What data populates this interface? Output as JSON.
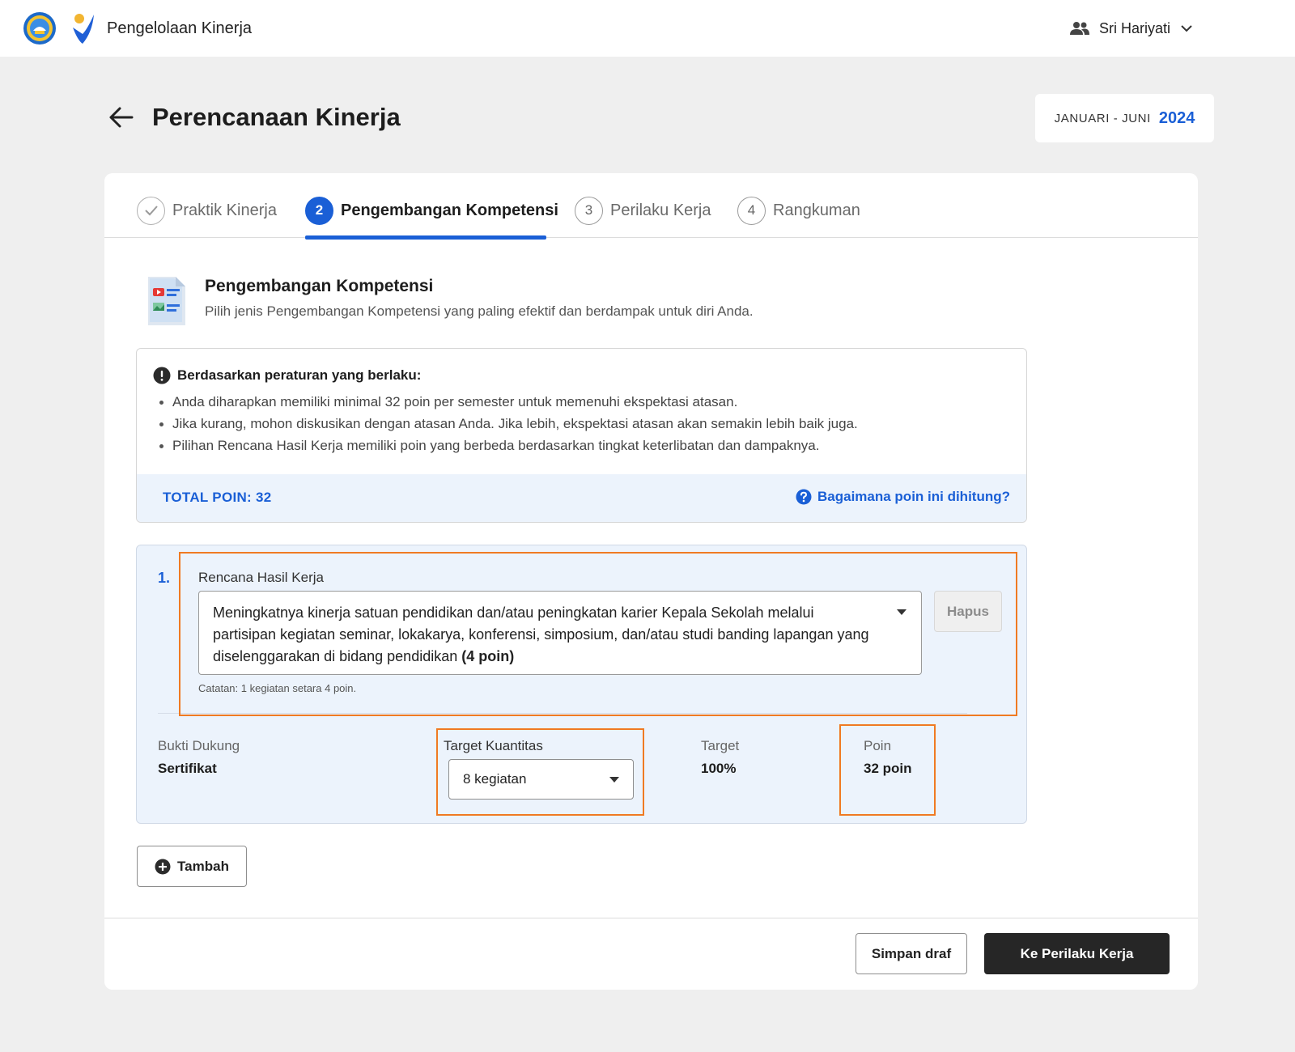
{
  "header": {
    "app_name": "Pengelolaan Kinerja",
    "user_name": "Sri Hariyati"
  },
  "page": {
    "title": "Perencanaan Kinerja",
    "period_label": "JANUARI - JUNI",
    "period_year": "2024"
  },
  "steps": [
    {
      "number": "",
      "label": "Praktik Kinerja",
      "state": "completed"
    },
    {
      "number": "2",
      "label": "Pengembangan Kompetensi",
      "state": "active"
    },
    {
      "number": "3",
      "label": "Perilaku Kerja",
      "state": "pending"
    },
    {
      "number": "4",
      "label": "Rangkuman",
      "state": "pending"
    }
  ],
  "section": {
    "title": "Pengembangan Kompetensi",
    "subtitle": "Pilih jenis Pengembangan Kompetensi yang paling efektif dan berdampak untuk diri Anda."
  },
  "rules": {
    "heading": "Berdasarkan peraturan yang berlaku:",
    "items": [
      "Anda diharapkan memiliki minimal 32 poin per semester untuk memenuhi ekspektasi atasan.",
      "Jika kurang, mohon diskusikan dengan atasan Anda. Jika lebih, ekspektasi atasan akan semakin lebih baik juga.",
      "Pilihan Rencana Hasil Kerja memiliki poin yang berbeda berdasarkan tingkat keterlibatan dan dampaknya."
    ],
    "total_points": "TOTAL POIN: 32",
    "help_link": "Bagaimana poin ini dihitung?"
  },
  "item": {
    "number": "1.",
    "rhk_label": "Rencana Hasil Kerja",
    "rhk_value": "Meningkatnya kinerja satuan pendidikan dan/atau peningkatan karier Kepala Sekolah melalui partisipan kegiatan seminar, lokakarya, konferensi, simposium, dan/atau studi banding lapangan yang diselenggarakan di bidang pendidikan",
    "rhk_points": "(4 poin)",
    "delete_label": "Hapus",
    "note": "Catatan: 1 kegiatan setara 4 poin.",
    "bukti_label": "Bukti Dukung",
    "bukti_value": "Sertifikat",
    "target_qty_label": "Target Kuantitas",
    "target_qty_value": "8 kegiatan",
    "target_label": "Target",
    "target_value": "100%",
    "poin_label": "Poin",
    "poin_value": "32 poin"
  },
  "actions": {
    "add_label": "Tambah",
    "draft_label": "Simpan draf",
    "next_label": "Ke Perilaku Kerja"
  },
  "colors": {
    "accent": "#1a5fd6",
    "highlight": "#f07a22",
    "primary_button": "#262626"
  }
}
